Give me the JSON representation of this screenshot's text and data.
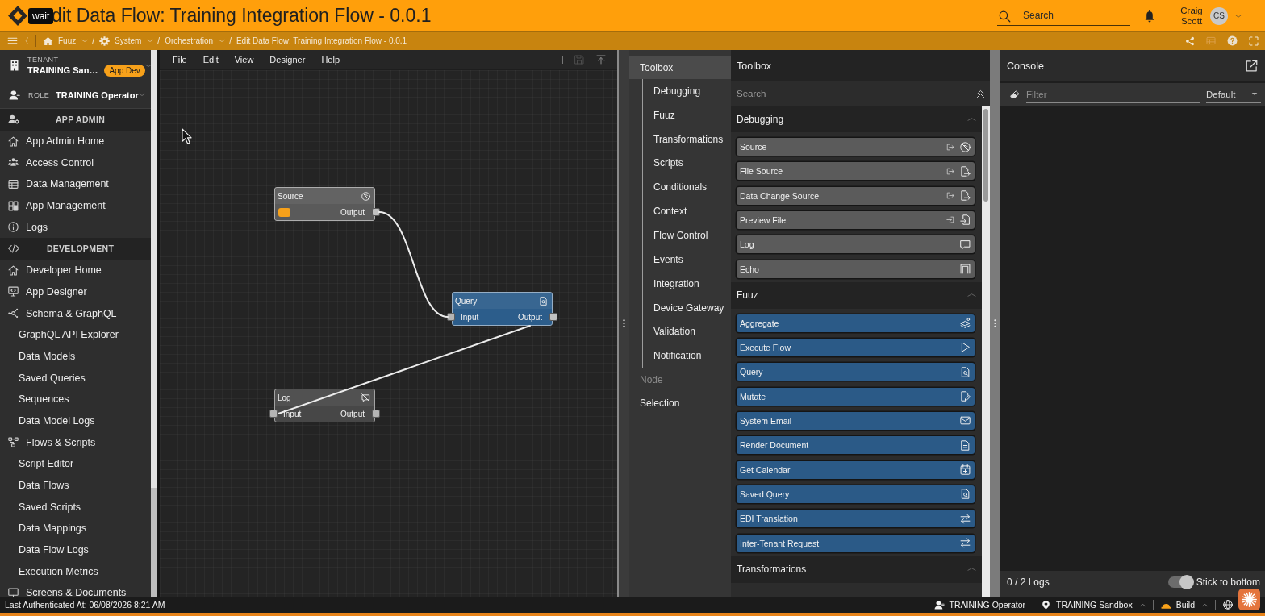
{
  "header": {
    "cursor_tooltip": "wait",
    "title": "dit Data Flow: Training Integration Flow - 0.0.1",
    "search": {
      "placeholder": "Search"
    },
    "user": {
      "name": "Craig Scott",
      "initials": "CS"
    }
  },
  "breadcrumb": {
    "separator": "/",
    "items": [
      {
        "label": "Fuuz",
        "dropdown": true
      },
      {
        "label": "System",
        "dropdown": true
      },
      {
        "label": "Orchestration",
        "dropdown": true
      },
      {
        "label": "Edit Data Flow: Training Integration Flow - 0.0.1",
        "dropdown": false
      }
    ]
  },
  "sidebar": {
    "tenant": {
      "label": "TENANT",
      "value": "TRAINING San…",
      "badge": "App Dev"
    },
    "role": {
      "label": "ROLE",
      "value": "TRAINING Operator"
    },
    "sections": [
      {
        "title": "APP ADMIN",
        "items": [
          {
            "label": "App Admin Home"
          },
          {
            "label": "Access Control"
          },
          {
            "label": "Data Management"
          },
          {
            "label": "App Management"
          },
          {
            "label": "Logs"
          }
        ]
      },
      {
        "title": "DEVELOPMENT",
        "items": [
          {
            "label": "Developer Home"
          },
          {
            "label": "App Designer"
          },
          {
            "label": "Schema & GraphQL",
            "children": [
              {
                "label": "GraphQL API Explorer"
              },
              {
                "label": "Data Models"
              },
              {
                "label": "Saved Queries"
              },
              {
                "label": "Sequences"
              },
              {
                "label": "Data Model Logs"
              }
            ]
          },
          {
            "label": "Flows & Scripts",
            "children": [
              {
                "label": "Script Editor"
              },
              {
                "label": "Data Flows"
              },
              {
                "label": "Saved Scripts"
              },
              {
                "label": "Data Mappings"
              },
              {
                "label": "Data Flow Logs"
              },
              {
                "label": "Execution Metrics"
              }
            ]
          },
          {
            "label": "Screens & Documents"
          }
        ]
      }
    ]
  },
  "canvas": {
    "menu": [
      "File",
      "Edit",
      "View",
      "Designer",
      "Help"
    ],
    "toolbar": [
      {
        "disabled": true
      },
      {
        "disabled": false
      }
    ],
    "nodes": [
      {
        "title": "Source",
        "color": "#5a5a5a",
        "output": "Output",
        "trigger": true,
        "linked": true
      },
      {
        "title": "Query",
        "color": "#2c5d8b",
        "input": "Input",
        "output": "Output",
        "trigger": false,
        "linked": true
      },
      {
        "title": "Log",
        "color": "#474747",
        "input": "Input",
        "output": "Output",
        "trigger": false,
        "linked": false
      }
    ]
  },
  "toolbox_nav": {
    "items": [
      {
        "label": "Toolbox",
        "selected": true,
        "disabled": false,
        "children": [
          {
            "label": "Debugging",
            "selected": false
          },
          {
            "label": "Fuuz",
            "selected": false
          },
          {
            "label": "Transformations",
            "selected": false
          },
          {
            "label": "Scripts",
            "selected": false
          },
          {
            "label": "Conditionals",
            "selected": false
          },
          {
            "label": "Context",
            "selected": false
          },
          {
            "label": "Flow Control",
            "selected": false
          },
          {
            "label": "Events",
            "selected": false
          },
          {
            "label": "Integration",
            "selected": false
          },
          {
            "label": "Device Gateway",
            "selected": false
          },
          {
            "label": "Validation",
            "selected": false
          },
          {
            "label": "Notification",
            "selected": false
          }
        ]
      },
      {
        "label": "Node",
        "selected": false,
        "disabled": true
      },
      {
        "label": "Selection",
        "selected": false,
        "disabled": false
      }
    ]
  },
  "toolbox": {
    "title": "Toolbox",
    "search": {
      "placeholder": "Search"
    },
    "sections": [
      {
        "title": "Debugging",
        "expanded": true,
        "items": [
          "Source",
          "File Source",
          "Data Change Source",
          "Preview File",
          "Log",
          "Echo"
        ]
      },
      {
        "title": "Fuuz",
        "expanded": true,
        "items": [
          "Aggregate",
          "Execute Flow",
          "Query",
          "Mutate",
          "System Email",
          "Render Document",
          "Get Calendar",
          "Saved Query",
          "EDI Translation",
          "Inter-Tenant Request"
        ]
      },
      {
        "title": "Transformations",
        "expanded": true
      }
    ]
  },
  "console": {
    "title": "Console",
    "filter": {
      "placeholder": "Filter"
    },
    "level": "Default",
    "count": "0 / 2 Logs",
    "stick_to_bottom": {
      "label": "Stick to bottom",
      "on": true
    }
  },
  "status_bar": {
    "last_authenticated": "Last Authenticated At: 06/08/2026 8:21 AM",
    "items": [
      {
        "label": "TRAINING Operator",
        "dropdown": false
      },
      {
        "label": "TRAINING Sandbox",
        "dropdown": true
      },
      {
        "label": "Build",
        "dropdown": true
      }
    ]
  }
}
